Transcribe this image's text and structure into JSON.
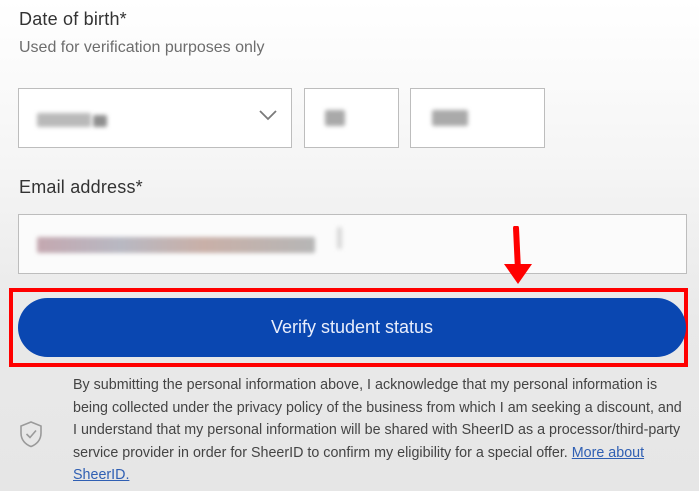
{
  "dob": {
    "label": "Date of birth*",
    "hint": "Used for verification purposes only",
    "month_value": "",
    "day_value": "",
    "year_value": ""
  },
  "email": {
    "label": "Email address*",
    "value": ""
  },
  "verify": {
    "button_label": "Verify student status",
    "highlight_color": "#ff0000",
    "button_color": "#0a47b1"
  },
  "disclaimer": {
    "text": "By submitting the personal information above, I acknowledge that my personal information is being collected under the privacy policy of the business from which I am seeking a discount, and I understand that my personal information will be shared with SheerID as a processor/third-party service provider in order for SheerID to confirm my eligibility for a special offer.",
    "link_text": "More about SheerID."
  },
  "icons": {
    "dropdown": "chevron-down-icon",
    "annotation": "red-arrow-down-icon",
    "privacy": "shield-check-icon"
  }
}
